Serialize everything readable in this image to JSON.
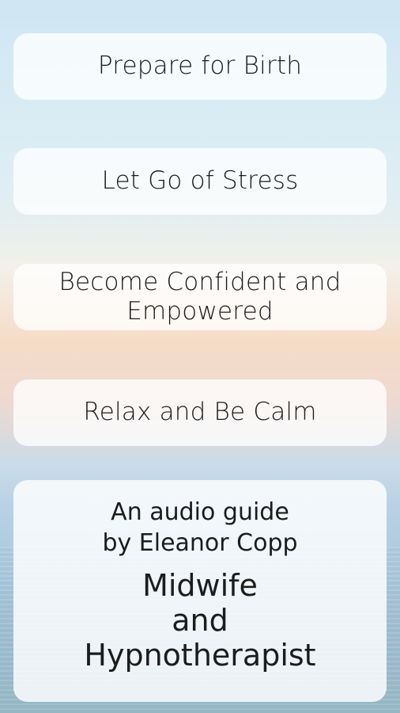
{
  "menu": {
    "items": [
      {
        "label": "Prepare for Birth"
      },
      {
        "label": "Let Go of Stress"
      },
      {
        "label": "Become Confident and\nEmpowered"
      },
      {
        "label": "Relax and Be Calm"
      }
    ]
  },
  "info": {
    "byline": "An audio guide\nby Eleanor Copp",
    "profession": "Midwife\nand\nHypnotherapist"
  }
}
